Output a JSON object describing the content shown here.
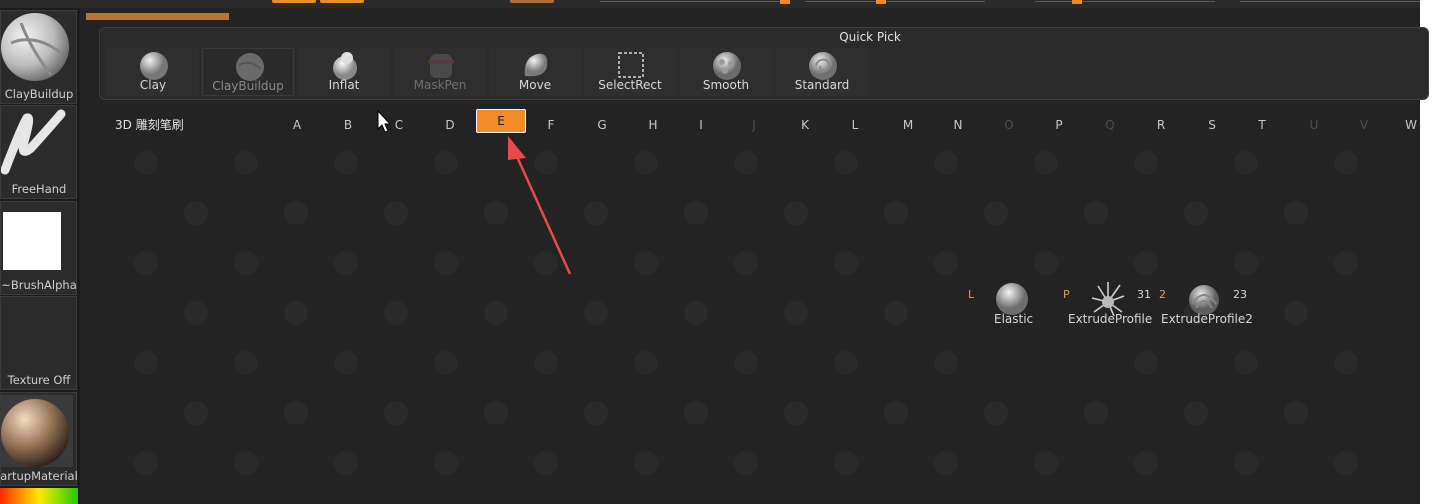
{
  "left_tray": {
    "items": [
      {
        "label": "ClayBuildup",
        "icon": "clay-buildup-brush-icon"
      },
      {
        "label": "FreeHand",
        "icon": "freehand-stroke-icon"
      },
      {
        "label": "~BrushAlpha",
        "icon": "brush-alpha-icon"
      },
      {
        "label": "Texture Off",
        "icon": "texture-off-icon"
      },
      {
        "label": "artupMaterial",
        "icon": "startup-material-icon"
      }
    ]
  },
  "quick_pick": {
    "title": "Quick Pick",
    "items": [
      {
        "label": "Clay"
      },
      {
        "label": "ClayBuildup"
      },
      {
        "label": "Inflat"
      },
      {
        "label": "MaskPen"
      },
      {
        "label": "Move"
      },
      {
        "label": "SelectRect"
      },
      {
        "label": "Smooth"
      },
      {
        "label": "Standard"
      }
    ]
  },
  "brush_palette": {
    "title": "3D 雕刻笔刷",
    "letters": [
      "A",
      "B",
      "C",
      "D",
      "E",
      "F",
      "G",
      "H",
      "I",
      "J",
      "K",
      "L",
      "M",
      "N",
      "O",
      "P",
      "Q",
      "R",
      "S",
      "T",
      "U",
      "V",
      "W"
    ],
    "active_letter": "E",
    "results": [
      {
        "tag": "L",
        "label": "Elastic",
        "count": ""
      },
      {
        "tag": "P",
        "label": "ExtrudeProfile",
        "count": "31"
      },
      {
        "tag": "2",
        "label": "ExtrudeProfile2",
        "count": "23"
      }
    ]
  },
  "colors": {
    "accent": "#f28c2a",
    "panel": "#2b2b2b",
    "background": "#232323",
    "annotation_arrow": "#e84a4a"
  }
}
